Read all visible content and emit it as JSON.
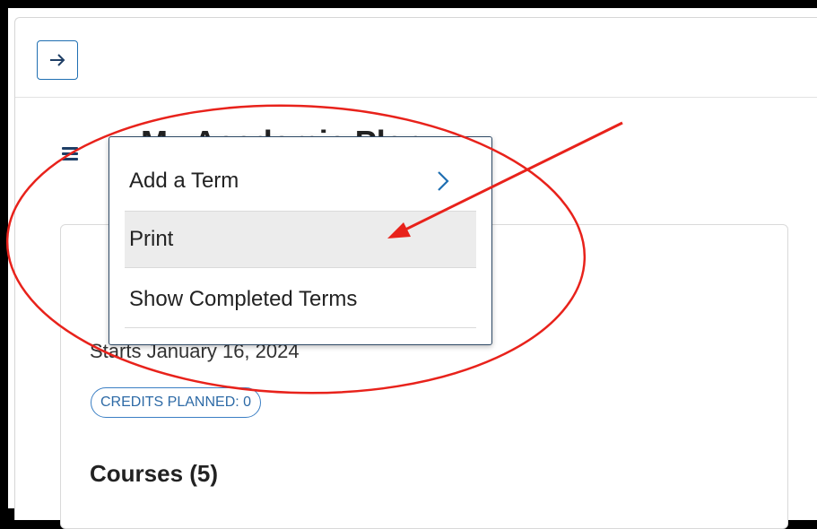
{
  "header": {
    "collapse_icon": "arrow-right-icon"
  },
  "page": {
    "title": "My Academic Plan",
    "menu_icon": "hamburger-menu-icon"
  },
  "term_card": {
    "start_text": "Starts January 16, 2024",
    "credits_badge": "CREDITS PLANNED: 0",
    "courses_heading": "Courses (5)"
  },
  "dropdown": {
    "items": [
      {
        "label": "Add a Term",
        "icon": "chevron-right-icon"
      },
      {
        "label": "Print"
      },
      {
        "label": "Show Completed Terms"
      }
    ],
    "highlighted": "Print"
  },
  "colors": {
    "accent": "#1f6fb2",
    "annotation": "#e8221b",
    "menu_highlight": "#ececec"
  }
}
